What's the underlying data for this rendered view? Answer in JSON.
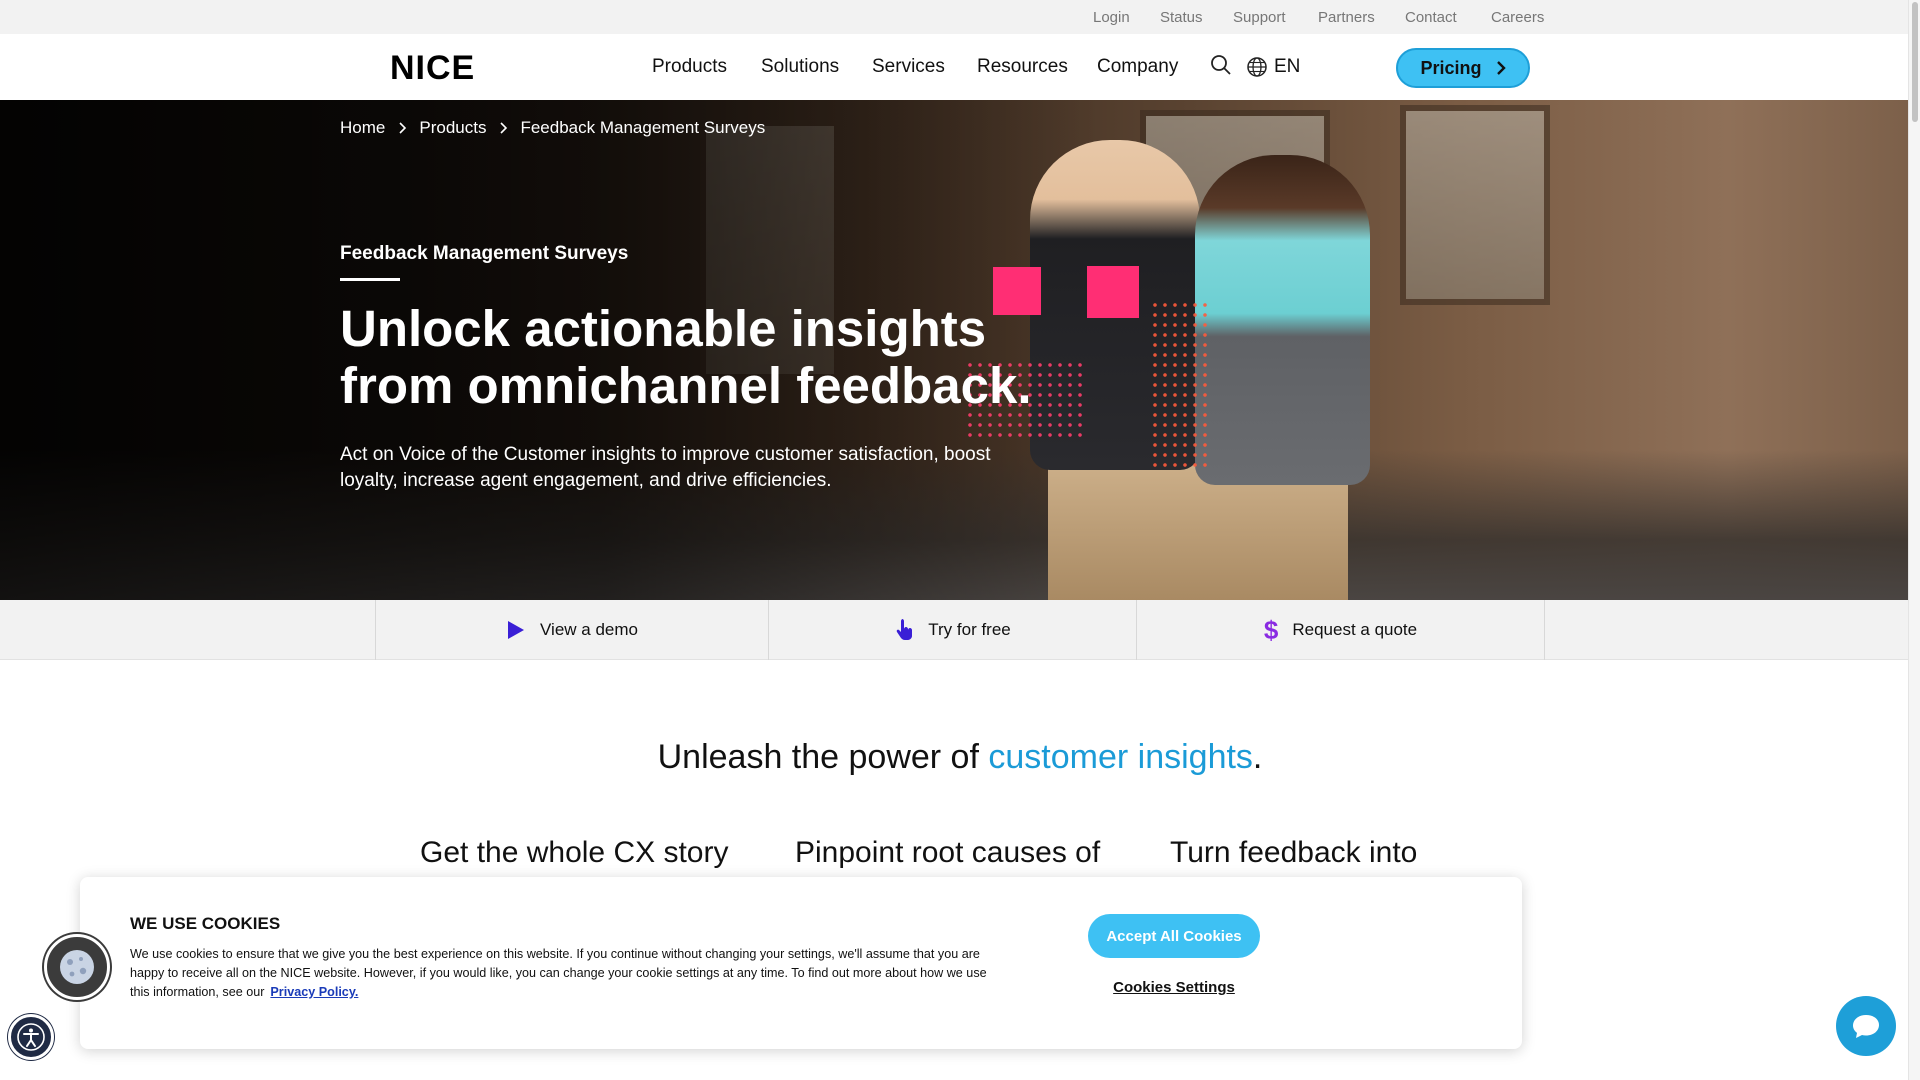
{
  "utility_nav": [
    "Login",
    "Status",
    "Support",
    "Partners",
    "Contact",
    "Careers"
  ],
  "nav": {
    "logo": "NICE",
    "items": [
      "Products",
      "Solutions",
      "Services",
      "Resources",
      "Company"
    ],
    "language": "EN",
    "pricing": "Pricing"
  },
  "breadcrumb": [
    "Home",
    "Products",
    "Feedback Management Surveys"
  ],
  "hero": {
    "eyebrow": "Feedback Management Surveys",
    "headline": "Unlock actionable insights from omnichannel feedback.",
    "subhead": "Act on Voice of the Customer insights to improve customer satisfaction, boost loyalty, increase agent engagement, and drive efficiencies."
  },
  "actions": [
    {
      "label": "View a demo",
      "icon": "play-icon"
    },
    {
      "label": "Try for free",
      "icon": "pointer-hand-icon"
    },
    {
      "label": "Request a quote",
      "icon": "dollar-icon"
    }
  ],
  "section": {
    "title_prefix": "Unleash the power of ",
    "title_accent": "customer insights",
    "title_suffix": ".",
    "columns": [
      "Get the whole CX story",
      "Pinpoint root causes of",
      "Turn feedback into"
    ]
  },
  "cookie": {
    "title": "WE USE COOKIES",
    "text": "We use cookies to ensure that we give you the best experience on this website. If you continue without changing your settings, we'll assume that you are happy to receive all on the NICE website. However, if you would like, you can change your cookie settings at any time. To find out more about how we use this information, see our",
    "link": "Privacy Policy.",
    "accept": "Accept All Cookies",
    "settings": "Cookies Settings"
  },
  "colors": {
    "accent": "#3ec1f3",
    "accent_text": "#1b9bd7",
    "hero_pink": "#ff2e74",
    "action_icon": "#3a1fd6",
    "dollar_icon": "#8a2be2"
  }
}
